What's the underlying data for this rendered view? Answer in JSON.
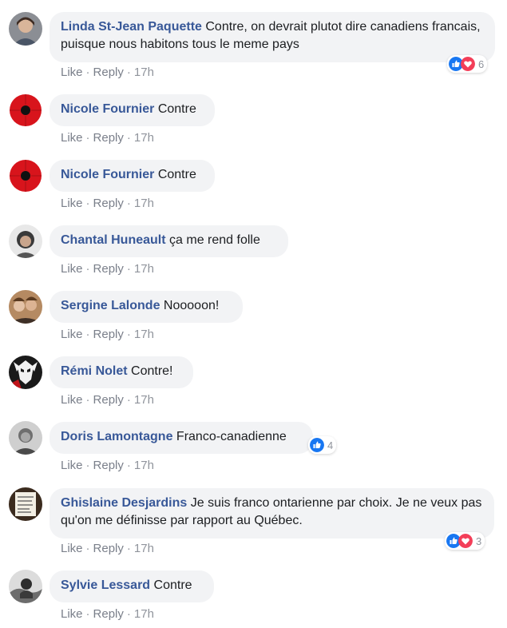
{
  "actions": {
    "like": "Like",
    "reply": "Reply",
    "separator": "·"
  },
  "colors": {
    "author": "#385898",
    "bubble": "#f2f3f5",
    "like": "#1877f2",
    "love": "#f33e58"
  },
  "comments": [
    {
      "author": "Linda St-Jean Paquette",
      "text": "Contre, on devrait plutot dire canadiens francais, puisque nous habitons tous le meme pays",
      "time": "17h",
      "reactions": {
        "icons": [
          "like-icon",
          "love-icon"
        ],
        "count": "6"
      }
    },
    {
      "author": "Nicole Fournier",
      "text": "Contre",
      "time": "17h"
    },
    {
      "author": "Nicole Fournier",
      "text": "Contre",
      "time": "17h"
    },
    {
      "author": "Chantal Huneault",
      "text": "ça me rend folle",
      "time": "17h"
    },
    {
      "author": "Sergine Lalonde",
      "text": "Nooooon!",
      "time": "17h"
    },
    {
      "author": "Rémi Nolet",
      "text": "Contre!",
      "time": "17h"
    },
    {
      "author": "Doris Lamontagne",
      "text": "Franco-canadienne",
      "time": "17h",
      "reactions": {
        "icons": [
          "like-icon"
        ],
        "count": "4"
      }
    },
    {
      "author": "Ghislaine Desjardins",
      "text": "Je suis franco ontarienne par choix. Je ne veux pas qu'on me définisse par rapport au Québec.",
      "time": "17h",
      "reactions": {
        "icons": [
          "like-icon",
          "love-icon"
        ],
        "count": "3"
      }
    },
    {
      "author": "Sylvie Lessard",
      "text": "Contre",
      "time": "17h"
    }
  ]
}
